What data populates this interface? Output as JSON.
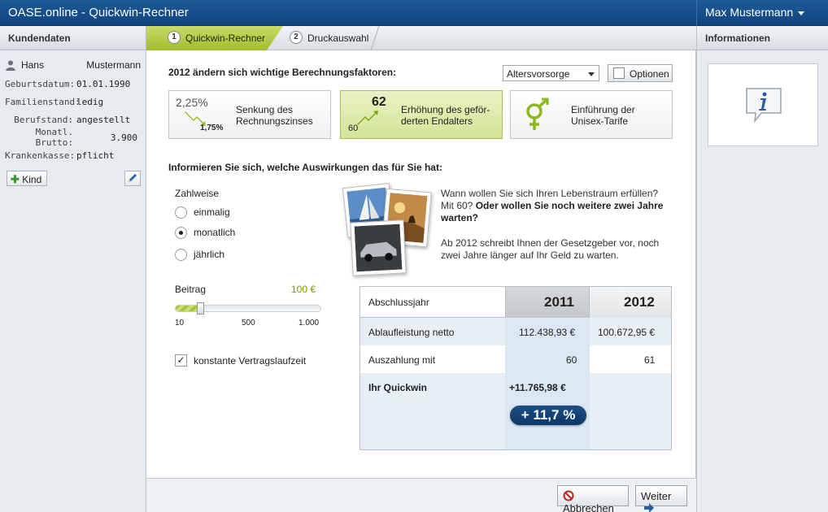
{
  "window": {
    "title": "OASE.online - Quickwin-Rechner",
    "user": "Max Mustermann"
  },
  "left_panel": {
    "heading": "Kundendaten",
    "first_name": "Hans",
    "last_name": "Mustermann",
    "fields": [
      {
        "label": "Geburtsdatum:",
        "value": "01.01.1990"
      },
      {
        "label": "Familienstand:",
        "value": "ledig"
      },
      {
        "label": "Berufstand:",
        "value": "angestellt"
      },
      {
        "label": "Monatl. Brutto:",
        "value": "3.900"
      },
      {
        "label": "Krankenkasse:",
        "value": "pflicht"
      }
    ],
    "add_child_label": "Kind"
  },
  "right_panel": {
    "heading": "Informationen"
  },
  "steps": [
    {
      "num": "1",
      "label": "Quickwin-Rechner",
      "active": true
    },
    {
      "num": "2",
      "label": "Druckauswahl",
      "active": false
    }
  ],
  "main": {
    "factors_heading": "2012 ändern sich wichtige Berechnungsfaktoren:",
    "dropdown_value": "Altersvorsorge",
    "options_label": "Optionen",
    "factors": [
      {
        "line1": "Senkung des",
        "line2": "Rechnungszinses",
        "big": "2,25%",
        "small": "1,75%"
      },
      {
        "line1": "Erhöhung des geför-",
        "line2": "derten Endalters",
        "big": "62",
        "small": "60"
      },
      {
        "line1": "Einführung der",
        "line2": "Unisex-Tarife"
      }
    ],
    "info_heading": "Informieren Sie sich, welche Auswirkungen das für Sie hat:",
    "payment_label": "Zahlweise",
    "payment_options": [
      "einmalig",
      "monatlich",
      "jährlich"
    ],
    "payment_selected": 1,
    "contribution_label": "Beitrag",
    "contribution_value": "100 €",
    "slider": {
      "min": 10,
      "max": 1000,
      "value": 100,
      "ticks": [
        "10",
        "500",
        "1.000"
      ]
    },
    "constant_term_label": "konstante Vertragslaufzeit",
    "constant_term_checked": true,
    "question_normal": "Wann wollen Sie sich Ihren Lebenstraum erfüllen? Mit 60?",
    "question_bold": "Oder wollen Sie noch weitere zwei Jahre warten?",
    "info_text": "Ab 2012 schreibt Ihnen der Gesetzgeber vor, noch zwei Jahre länger auf Ihr Geld zu warten."
  },
  "table": {
    "header_label": "Abschlussjahr",
    "year1": "2011",
    "year2": "2012",
    "rows": [
      {
        "label": "Ablaufleistung netto",
        "v1": "112.438,93 €",
        "v2": "100.672,95 €"
      },
      {
        "label": "Auszahlung mit",
        "v1": "60",
        "v2": "61"
      }
    ],
    "quickwin_label": "Ihr Quickwin",
    "quickwin_value": "+11.765,98 €",
    "quickwin_percent": "+ 11,7 %"
  },
  "footer": {
    "cancel_label": "Abbrechen",
    "next_label": "Weiter"
  },
  "colors": {
    "titlebar": "#0f4580",
    "accent_green": "#9dbd2c",
    "badge_blue": "#0d3566"
  }
}
